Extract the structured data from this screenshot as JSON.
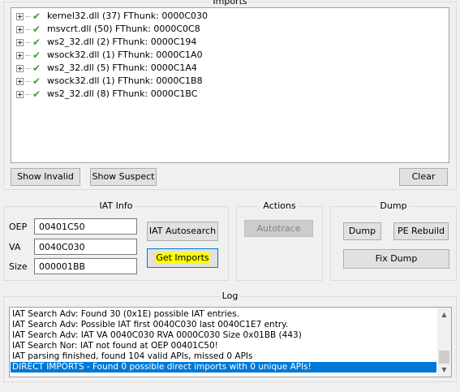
{
  "imports": {
    "title": "Imports",
    "items": [
      {
        "label": "kernel32.dll (37) FThunk: 0000C030"
      },
      {
        "label": "msvcrt.dll (50) FThunk: 0000C0C8"
      },
      {
        "label": "ws2_32.dll (2) FThunk: 0000C194"
      },
      {
        "label": "wsock32.dll (1) FThunk: 0000C1A0"
      },
      {
        "label": "ws2_32.dll (5) FThunk: 0000C1A4"
      },
      {
        "label": "wsock32.dll (1) FThunk: 0000C1B8"
      },
      {
        "label": "ws2_32.dll (8) FThunk: 0000C1BC"
      }
    ],
    "show_invalid_label": "Show Invalid",
    "show_suspect_label": "Show Suspect",
    "clear_label": "Clear"
  },
  "iat_info": {
    "title": "IAT Info",
    "oep_label": "OEP",
    "oep_value": "00401C50",
    "va_label": "VA",
    "va_value": "0040C030",
    "size_label": "Size",
    "size_value": "000001BB",
    "autosearch_label": "IAT Autosearch",
    "get_imports_label": "Get Imports"
  },
  "actions": {
    "title": "Actions",
    "autotrace_label": "Autotrace"
  },
  "dump": {
    "title": "Dump",
    "dump_label": "Dump",
    "pe_rebuild_label": "PE Rebuild",
    "fix_dump_label": "Fix Dump"
  },
  "log": {
    "title": "Log",
    "lines": [
      "IAT Search Adv: Found 30 (0x1E) possible IAT entries.",
      "IAT Search Adv: Possible IAT first 0040C030 last 0040C1E7 entry.",
      "IAT Search Adv: IAT VA 0040C030 RVA 0000C030 Size 0x01BB (443)",
      "IAT Search Nor: IAT not found at OEP 00401C50!",
      "IAT parsing finished, found 104 valid APIs, missed 0 APIs",
      "DIRECT IMPORTS - Found 0 possible direct imports with 0 unique APIs!"
    ],
    "selected_index": 5
  },
  "colors": {
    "check": "#3a9e3a",
    "selection": "#0078d7",
    "highlight": "#ffff00"
  }
}
